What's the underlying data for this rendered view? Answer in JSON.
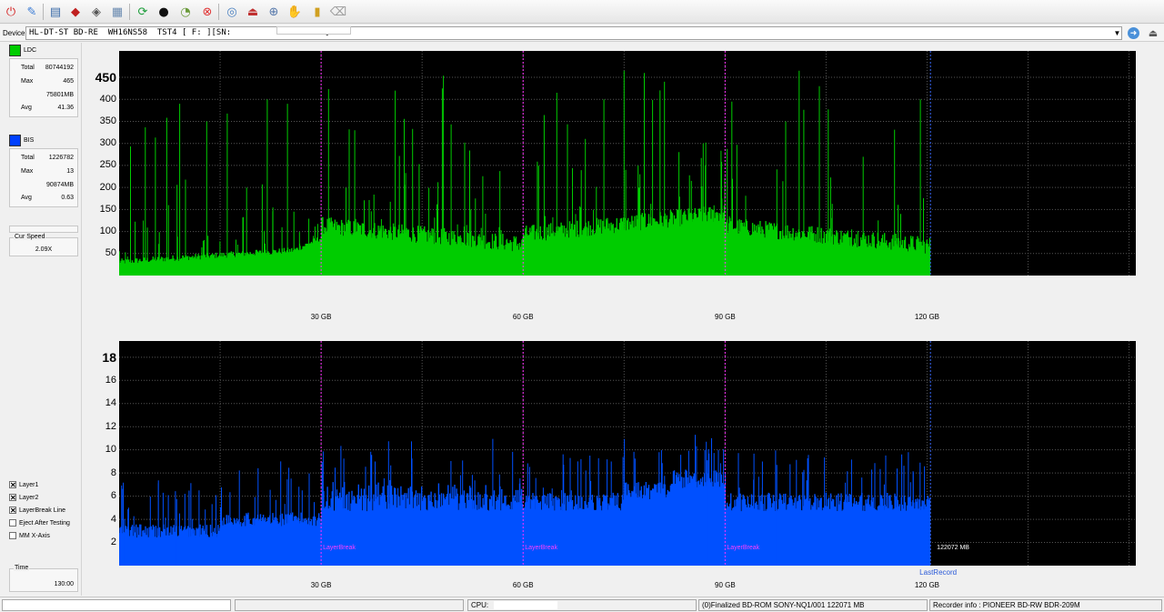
{
  "toolbar": {
    "icons": [
      "power-icon",
      "erase-icon",
      "drive-info-icon",
      "disc-red-icon",
      "disc-gray-icon",
      "disc-copy-icon",
      "refresh-icon",
      "disc-black-icon",
      "gauge-icon",
      "stop-icon",
      "burn-icon",
      "eject-icon",
      "save-icon",
      "scan-icon",
      "chart-icon",
      "clear-icon"
    ]
  },
  "device": {
    "label": "Device:",
    "value": "HL-DT-ST BD-RE  WH16NS58  TST4 [ F: ][SN:                   ]",
    "dropdown_icon": "chevron-down-icon"
  },
  "sidebar": {
    "ldc": {
      "label": "LDC",
      "color": "#00cc00",
      "total_label": "Total",
      "total": "80744192",
      "max_label": "Max",
      "max": "465",
      "mb": "75801MB",
      "avg_label": "Avg",
      "avg": "41.36"
    },
    "bis": {
      "label": "BIS",
      "color": "#0040ff",
      "total_label": "Total",
      "total": "1226782",
      "max_label": "Max",
      "max": "13",
      "mb": "90874MB",
      "avg_label": "Avg",
      "avg": "0.63"
    },
    "cur_speed_label": "Cur Speed",
    "cur_speed": "2.09X",
    "checks": [
      {
        "label": "Layer1",
        "checked": true
      },
      {
        "label": "Layer2",
        "checked": true
      },
      {
        "label": "LayerBreak Line",
        "checked": true
      },
      {
        "label": "Eject After Testing",
        "checked": false
      },
      {
        "label": "MM X-Axis",
        "checked": false
      }
    ],
    "time_label": "Time",
    "time": "130:00"
  },
  "chart_data": [
    {
      "type": "area",
      "series": [
        {
          "name": "LDC",
          "color": "#00cc00"
        }
      ],
      "y_ticks": [
        "450",
        "400",
        "350",
        "300",
        "250",
        "200",
        "150",
        "100",
        "50"
      ],
      "y_max_label": "450",
      "ylim": [
        0,
        510
      ],
      "xlim": [
        0,
        151
      ],
      "x_ticks": [
        "30 GB",
        "60 GB",
        "90 GB",
        "120 GB"
      ],
      "x_tick_values": [
        30,
        60,
        90,
        120
      ],
      "layer_breaks": [
        30,
        60,
        90
      ],
      "last_record": 120.5,
      "max": 465,
      "avg": 41.36
    },
    {
      "type": "area",
      "series": [
        {
          "name": "BIS",
          "color": "#0050ff"
        }
      ],
      "y_ticks": [
        "18",
        "16",
        "14",
        "12",
        "10",
        "8",
        "6",
        "4",
        "2"
      ],
      "y_max_label": "18",
      "ylim": [
        0,
        19.4
      ],
      "xlim": [
        0,
        151
      ],
      "x_ticks": [
        "30 GB",
        "60 GB",
        "90 GB",
        "120 GB"
      ],
      "x_tick_values": [
        30,
        60,
        90,
        120
      ],
      "layer_breaks": [
        30,
        60,
        90
      ],
      "layer_break_label": "LayerBreak",
      "last_record": 120.5,
      "last_record_label": "LastRecord",
      "end_label": "122072 MB",
      "max": 13,
      "avg": 0.63
    }
  ],
  "status": {
    "cpu_label": "CPU:",
    "disc": "(0)Finalized   BD-ROM   SONY-NQ1/001   122071 MB",
    "recorder": "Recorder info : PIONEER        BD-RW   BDR-209M"
  }
}
